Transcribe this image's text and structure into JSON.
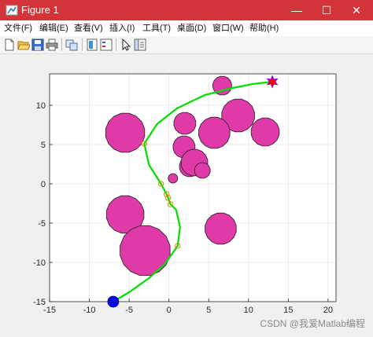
{
  "window": {
    "title": "Figure 1",
    "minimize_glyph": "—",
    "maximize_glyph": "☐",
    "close_glyph": "✕",
    "titlebar_color": "#d3343a"
  },
  "menu": [
    {
      "label": "文件(F)"
    },
    {
      "label": "编辑(E)"
    },
    {
      "label": "查看(V)"
    },
    {
      "label": "插入(I)"
    },
    {
      "label": "工具(T)"
    },
    {
      "label": "桌面(D)"
    },
    {
      "label": "窗口(W)"
    },
    {
      "label": "帮助(H)"
    }
  ],
  "toolbar": {
    "icons": [
      "new-figure-icon",
      "open-file-icon",
      "save-icon",
      "print-icon",
      "link-plot-icon",
      "insert-colorbar-icon",
      "insert-legend-icon",
      "edit-plot-arrow-icon",
      "property-inspector-icon"
    ]
  },
  "watermark": "CSDN @我爱Matlab编程",
  "chart_data": {
    "type": "scatter",
    "title": "",
    "xlabel": "",
    "ylabel": "",
    "xlim": [
      -15,
      21
    ],
    "ylim": [
      -15,
      14
    ],
    "xticks": [
      -15,
      -10,
      -5,
      0,
      5,
      10,
      15,
      20
    ],
    "yticks": [
      -15,
      -10,
      -5,
      0,
      5,
      10
    ],
    "grid": true,
    "obstacle_color": "#e03aa8",
    "path_color": "#00e000",
    "waypoint_color": "#d98c00",
    "start": {
      "x": -7,
      "y": -15,
      "color": "#0000ff"
    },
    "goal": {
      "x": 13,
      "y": 13,
      "color": "#ff0000"
    },
    "obstacles": [
      {
        "x": -5.5,
        "y": 6.5,
        "r": 2.5
      },
      {
        "x": 6.7,
        "y": 12.5,
        "r": 1.2
      },
      {
        "x": 8.7,
        "y": 8.7,
        "r": 2.1
      },
      {
        "x": 12.1,
        "y": 6.6,
        "r": 1.8
      },
      {
        "x": 2,
        "y": 7.7,
        "r": 1.4
      },
      {
        "x": 5.7,
        "y": 6.5,
        "r": 2.0
      },
      {
        "x": 1.9,
        "y": 4.7,
        "r": 1.4
      },
      {
        "x": 2.6,
        "y": 2.2,
        "r": 1.3
      },
      {
        "x": 3.2,
        "y": 2.7,
        "r": 1.7
      },
      {
        "x": 4.2,
        "y": 1.7,
        "r": 1.0
      },
      {
        "x": 0.5,
        "y": 0.7,
        "r": 0.6
      },
      {
        "x": -5.5,
        "y": -3.9,
        "r": 2.4
      },
      {
        "x": 6.5,
        "y": -5.7,
        "r": 2.0
      },
      {
        "x": -3,
        "y": -8.5,
        "r": 3.2
      }
    ],
    "path": [
      {
        "x": -7,
        "y": -15
      },
      {
        "x": -5,
        "y": -13.8
      },
      {
        "x": -2.5,
        "y": -12
      },
      {
        "x": -0.5,
        "y": -10.2
      },
      {
        "x": 1.1,
        "y": -7.9
      },
      {
        "x": 1.4,
        "y": -5.5
      },
      {
        "x": 0.9,
        "y": -3.3
      },
      {
        "x": 0.2,
        "y": -2.6
      },
      {
        "x": -0.1,
        "y": -1.8
      },
      {
        "x": -0.3,
        "y": -1.3
      },
      {
        "x": -1,
        "y": 0
      },
      {
        "x": -2.5,
        "y": 2.4
      },
      {
        "x": -3.1,
        "y": 5.1
      },
      {
        "x": -1.5,
        "y": 7.6
      },
      {
        "x": 1,
        "y": 9.6
      },
      {
        "x": 4.5,
        "y": 11.3
      },
      {
        "x": 8,
        "y": 12.2
      },
      {
        "x": 10.5,
        "y": 12.7
      },
      {
        "x": 13,
        "y": 13
      }
    ],
    "waypoints": [
      {
        "x": 1.1,
        "y": -7.9
      },
      {
        "x": 0.2,
        "y": -2.6
      },
      {
        "x": -0.1,
        "y": -1.8
      },
      {
        "x": -0.3,
        "y": -1.3
      },
      {
        "x": -1,
        "y": 0
      },
      {
        "x": -3.1,
        "y": 5.1
      }
    ]
  }
}
